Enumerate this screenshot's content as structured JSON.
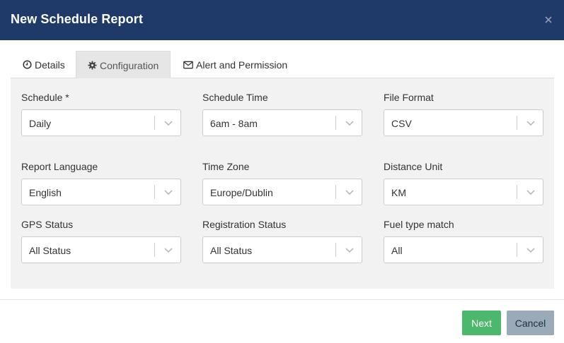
{
  "dialog": {
    "title": "New Schedule Report"
  },
  "tabs": [
    {
      "label": "Details",
      "icon": "clock-icon",
      "active": false
    },
    {
      "label": "Configuration",
      "icon": "gear-icon",
      "active": true
    },
    {
      "label": "Alert and Permission",
      "icon": "envelope-icon",
      "active": false
    }
  ],
  "fields": {
    "schedule": {
      "label": "Schedule *",
      "value": "Daily"
    },
    "schedule_time": {
      "label": "Schedule Time",
      "value": "6am - 8am"
    },
    "file_format": {
      "label": "File Format",
      "value": "CSV"
    },
    "report_language": {
      "label": "Report Language",
      "value": "English"
    },
    "time_zone": {
      "label": "Time Zone",
      "value": "Europe/Dublin"
    },
    "distance_unit": {
      "label": "Distance Unit",
      "value": "KM"
    },
    "gps_status": {
      "label": "GPS Status",
      "value": "All Status"
    },
    "registration_status": {
      "label": "Registration Status",
      "value": "All Status"
    },
    "fuel_type_match": {
      "label": "Fuel type match",
      "value": "All"
    }
  },
  "buttons": {
    "next": "Next",
    "cancel": "Cancel"
  },
  "colors": {
    "header_bg": "#1f3a68",
    "next_bg": "#4cb86e",
    "cancel_bg": "#9aaab8",
    "panel_bg": "#f2f2f2"
  }
}
